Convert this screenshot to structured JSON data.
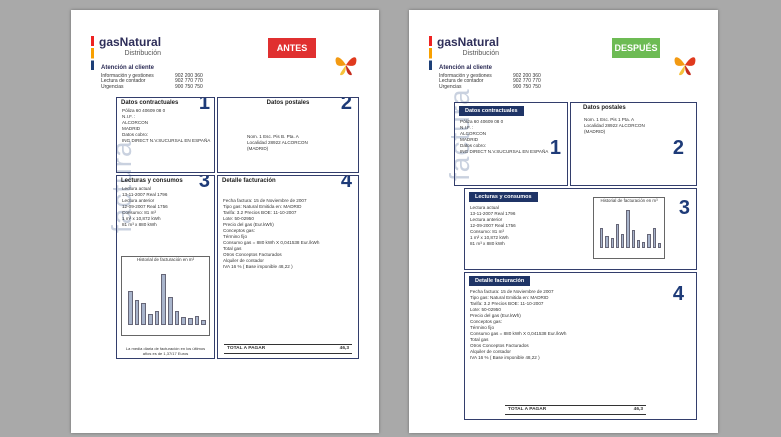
{
  "left": {
    "badge": "ANTES",
    "logo_main": "gasNatural",
    "logo_sub": "Distribución",
    "vertical_word": "factura",
    "contact": {
      "title": "Atención al cliente",
      "rows": [
        [
          "Información y gestiones",
          "902 200 360"
        ],
        [
          "Lectura de contador",
          "902 770 770"
        ],
        [
          "Urgencias",
          "900 750 750"
        ]
      ]
    },
    "boxes": {
      "contract": {
        "title": "Datos contractuales",
        "number": "1",
        "lines": [
          "Póliza        60 40609 08 0",
          "N.I.F. :",
          "",
          "ALCORCON",
          "MADRID",
          "Datos cobro:",
          "ING DIRECT N.V.SUCURSAL EN ESPAÑA"
        ]
      },
      "postal": {
        "title": "Datos postales",
        "number": "2",
        "lines": [
          "Nom.    1     Esc.     Pis  B.   Pta.  A",
          "Localidad    28922 ALCORCON",
          "(MADRID)"
        ]
      },
      "readings": {
        "title": "Lecturas y consumos",
        "number": "3",
        "lines": [
          "Lectura actual",
          "13-11-2007    Real         1796",
          "Lectura anterior",
          "12-09-2007    Real         1756",
          "",
          "Consumo:      81 m³",
          "",
          "1 m³ x    10,872 kWh",
          "81 m³ x   880 kWh"
        ],
        "chart_title": "Historial de facturación en m³",
        "chart_note": "La media diaria de facturación en los últimos años es de 1,37/17 Euros",
        "bars": [
          0.55,
          0.4,
          0.35,
          0.15,
          0.2,
          0.85,
          0.45,
          0.2,
          0.1,
          0.08,
          0.12,
          0.06
        ]
      },
      "billing": {
        "title": "Detalle facturación",
        "number": "4",
        "lines": [
          "Fecha factura:    15 de Noviembre de 2007",
          "Tipo gas:   Natural      Emitida en:     MADRID",
          "Tarifa:     3.2          Precios BOE:    11-10-2007",
          "Lote:       50-02950",
          "",
          "Precio del gas (Eur.kWh)",
          "",
          "Conceptos gas:",
          "Término fijo",
          "Consumo gas = 880 kWh X 0,041538 Eur./kWh",
          "Total gas",
          "Otros Conceptos Facturados",
          "Alquiler de contador",
          "",
          "IVA 16 %  ( Base imponible      48,22 )"
        ],
        "total_label": "TOTAL A PAGAR",
        "total_value": "46,3"
      }
    }
  },
  "right": {
    "badge": "DESPUÉS",
    "logo_main": "gasNatural",
    "logo_sub": "Distribución",
    "vertical_word": "factura",
    "contact": {
      "title": "Atención al cliente",
      "rows": [
        [
          "Información y gestiones",
          "902 200 360"
        ],
        [
          "Lectura de contador",
          "902 770 770"
        ],
        [
          "Urgencias",
          "900 750 750"
        ]
      ]
    },
    "boxes": {
      "contract": {
        "title": "Datos contractuales",
        "number": "1",
        "lines": [
          "Póliza        60 40609 08 0",
          "N.I.F. :",
          "",
          "ALCORCON",
          "MADRID",
          "Datos cobro:",
          "ING DIRECT N.V.SUCURSAL EN ESPAÑA"
        ]
      },
      "postal": {
        "title": "Datos postales",
        "number": "2",
        "lines": [
          "Nom.   1       Esc.      Pis  1   Pta.  A",
          "Localidad    28922 ALCORCON",
          "(MADRID)"
        ]
      },
      "readings": {
        "title": "Lecturas y consumos",
        "number": "3",
        "lines": [
          "Lectura actual",
          "13-11-2007    Real       1796",
          "Lectura anterior",
          "12-09-2007    Real       1756",
          "",
          "Consumo:     81 m³",
          "",
          "1 m³ x    10,872 kWh",
          "81 m³ x   880 kWh"
        ],
        "chart_title": "Historial de facturación en m³",
        "bars": [
          0.45,
          0.25,
          0.2,
          0.55,
          0.3,
          0.9,
          0.4,
          0.15,
          0.1,
          0.3,
          0.45,
          0.08
        ]
      },
      "billing": {
        "title": "Detalle facturación",
        "number": "4",
        "lines": [
          "Fecha factura:    15 de Noviembre de 2007",
          "",
          "Tipo gas:   Natural            Emitida en:     MADRID",
          "Tarifa:     3.2                Precios BOE:    11-10-2007",
          "Lote:       50-02950",
          "",
          "Precio del gas (Eur.kWh)",
          "",
          "Conceptos gas:",
          "Término fijo",
          "Consumo gas = 880 kWh X 0,041538 Eur./kWh",
          "Total gas",
          "Otros Conceptos Facturados",
          "Alquiler de contador",
          "",
          "IVA 16 %  ( Base imponible      48,22 )"
        ],
        "total_label": "TOTAL A PAGAR",
        "total_value": "46,3"
      }
    }
  }
}
